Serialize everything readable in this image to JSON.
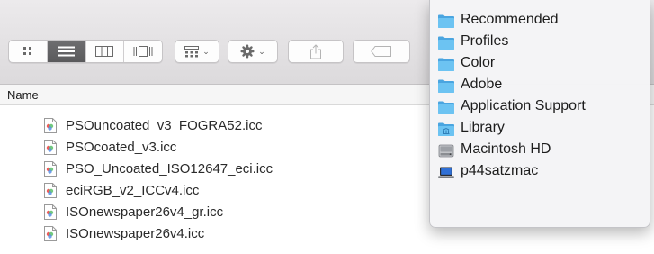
{
  "column_header": {
    "name": "Name"
  },
  "toolbar": {
    "view_buttons": [
      {
        "icon": "icon-view-icon",
        "active": false
      },
      {
        "icon": "list-view-icon",
        "active": true
      },
      {
        "icon": "column-view-icon",
        "active": false
      },
      {
        "icon": "cover-flow-icon",
        "active": false
      }
    ],
    "arrange_icon": "arrange-grid-icon",
    "action_icon": "gear-icon",
    "share_icon": "share-icon",
    "tag_icon": "tag-icon",
    "dropdown_glyph": "⌄"
  },
  "files": [
    {
      "name": "PSOuncoated_v3_FOGRA52.icc",
      "icon": "icc-profile-file-icon"
    },
    {
      "name": "PSOcoated_v3.icc",
      "icon": "icc-profile-file-icon"
    },
    {
      "name": "PSO_Uncoated_ISO12647_eci.icc",
      "icon": "icc-profile-file-icon"
    },
    {
      "name": "eciRGB_v2_ICCv4.icc",
      "icon": "icc-profile-file-icon"
    },
    {
      "name": "ISOnewspaper26v4_gr.icc",
      "icon": "icc-profile-file-icon"
    },
    {
      "name": "ISOnewspaper26v4.icc",
      "icon": "icc-profile-file-icon"
    }
  ],
  "path_menu": {
    "items": [
      {
        "label": "Recommended",
        "icon": "folder-icon"
      },
      {
        "label": "Profiles",
        "icon": "folder-icon"
      },
      {
        "label": "Color",
        "icon": "folder-icon"
      },
      {
        "label": "Adobe",
        "icon": "folder-icon"
      },
      {
        "label": "Application Support",
        "icon": "folder-icon"
      },
      {
        "label": "Library",
        "icon": "library-folder-icon"
      },
      {
        "label": "Macintosh HD",
        "icon": "hard-drive-icon"
      },
      {
        "label": "p44satzmac",
        "icon": "computer-icon"
      }
    ]
  },
  "colors": {
    "folder_blue": "#5ab4ea",
    "active_segment": "#626264",
    "menu_background": "#f4f4f6"
  }
}
